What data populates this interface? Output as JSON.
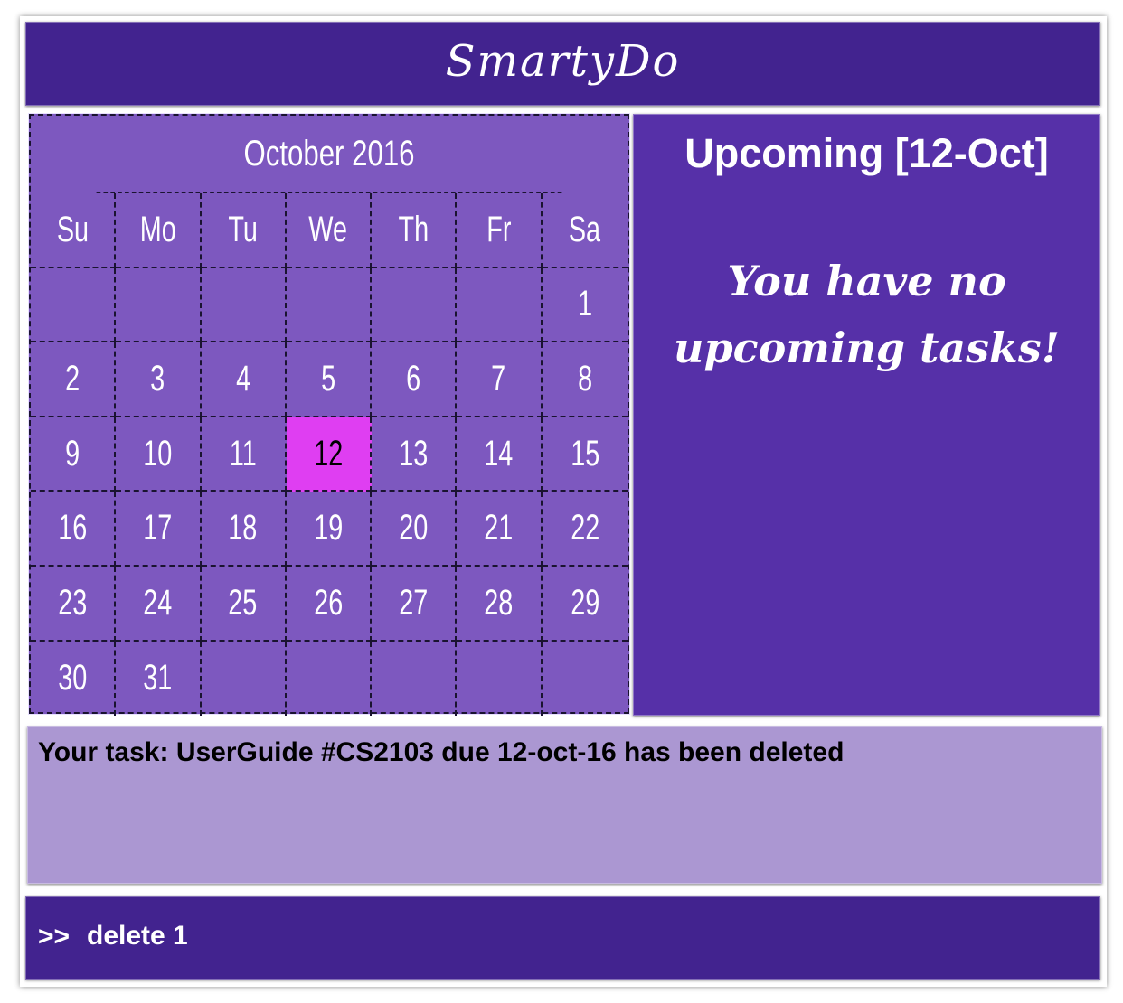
{
  "app": {
    "title": "SmartyDo"
  },
  "calendar": {
    "month_label": "October 2016",
    "weekdays": [
      "Su",
      "Mo",
      "Tu",
      "We",
      "Th",
      "Fr",
      "Sa"
    ],
    "weeks": [
      [
        "",
        "",
        "",
        "",
        "",
        "",
        "1"
      ],
      [
        "2",
        "3",
        "4",
        "5",
        "6",
        "7",
        "8"
      ],
      [
        "9",
        "10",
        "11",
        "12",
        "13",
        "14",
        "15"
      ],
      [
        "16",
        "17",
        "18",
        "19",
        "20",
        "21",
        "22"
      ],
      [
        "23",
        "24",
        "25",
        "26",
        "27",
        "28",
        "29"
      ],
      [
        "30",
        "31",
        "",
        "",
        "",
        "",
        ""
      ]
    ],
    "selected_day": "12"
  },
  "upcoming": {
    "title": "Upcoming [12-Oct]",
    "empty_message": "You have no upcoming tasks!"
  },
  "message": {
    "text": "Your task: UserGuide #CS2103 due 12-oct-16 has been deleted"
  },
  "command": {
    "prompt": ">>",
    "value": "delete 1"
  },
  "colors": {
    "header_bg": "#42238f",
    "calendar_bg": "#7d58bf",
    "selected_day_bg": "#df3ef2",
    "upcoming_bg": "#5630a8",
    "message_bg": "#ab97d2"
  }
}
